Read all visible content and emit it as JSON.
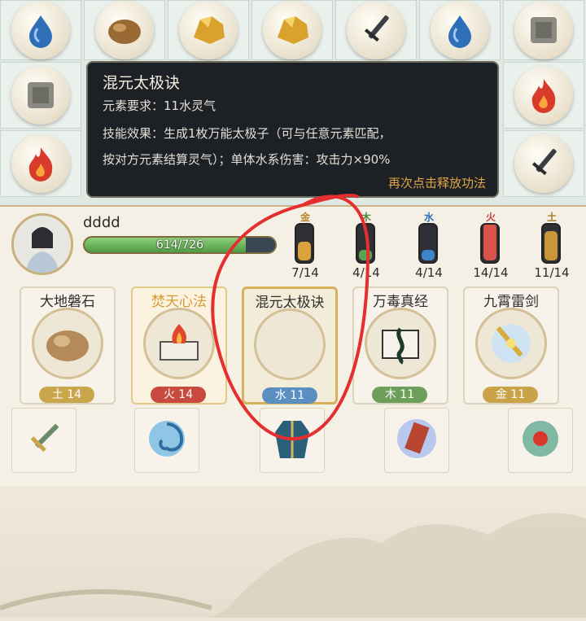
{
  "board": {
    "row1": [
      "water-orb",
      "earth-orb",
      "gold-orb",
      "gold-orb",
      "sword-orb",
      "water-orb",
      "stone-orb"
    ],
    "row2_left": "stone-orb",
    "row2_right": "fire-orb",
    "row3_left": "fire-orb",
    "row3_right": "sword-orb"
  },
  "tooltip": {
    "title": "混元太极诀",
    "requirement": "元素要求：11水灵气",
    "effect_line1": "技能效果：生成1枚万能太极子（可与任意元素匹配，",
    "effect_line2": "按对方元素结算灵气）；单体水系伤害：攻击力×90%",
    "hint": "再次点击释放功法"
  },
  "player": {
    "name": "dddd",
    "hp_text": "614/726",
    "hp_fraction": 0.846
  },
  "elements": [
    {
      "icon": "金",
      "count": "7/14",
      "fill": 0.5,
      "color": "#d9a23c",
      "icon_color": "#b8892e"
    },
    {
      "icon": "木",
      "count": "4/14",
      "fill": 0.29,
      "color": "#5aa24e",
      "icon_color": "#4e8b3f"
    },
    {
      "icon": "水",
      "count": "4/14",
      "fill": 0.29,
      "color": "#3f86c9",
      "icon_color": "#2f6fb6"
    },
    {
      "icon": "火",
      "count": "14/14",
      "fill": 1.0,
      "color": "#d9534a",
      "icon_color": "#c8443b"
    },
    {
      "icon": "土",
      "count": "11/14",
      "fill": 0.79,
      "color": "#c9973a",
      "icon_color": "#a77b2d"
    }
  ],
  "skills": [
    {
      "name": "大地磐石",
      "cost": "土 14",
      "cost_color": "#c9a54c",
      "icon": "rock-icon"
    },
    {
      "name": "焚天心法",
      "cost": "火 14",
      "cost_color": "#c84a3e",
      "icon": "burning-scroll-icon"
    },
    {
      "name": "混元太极诀",
      "cost": "水 11",
      "cost_color": "#5b8fc2",
      "icon": "empty-circle"
    },
    {
      "name": "万毒真经",
      "cost": "木 11",
      "cost_color": "#6d9f5a",
      "icon": "poison-scroll-icon"
    },
    {
      "name": "九霄雷剑",
      "cost": "金 11",
      "cost_color": "#caa349",
      "icon": "thunder-sword-icon"
    }
  ],
  "items": [
    "dagger-icon",
    "vortex-icon",
    "robe-icon",
    "scroll-icon",
    "red-gem-icon"
  ]
}
